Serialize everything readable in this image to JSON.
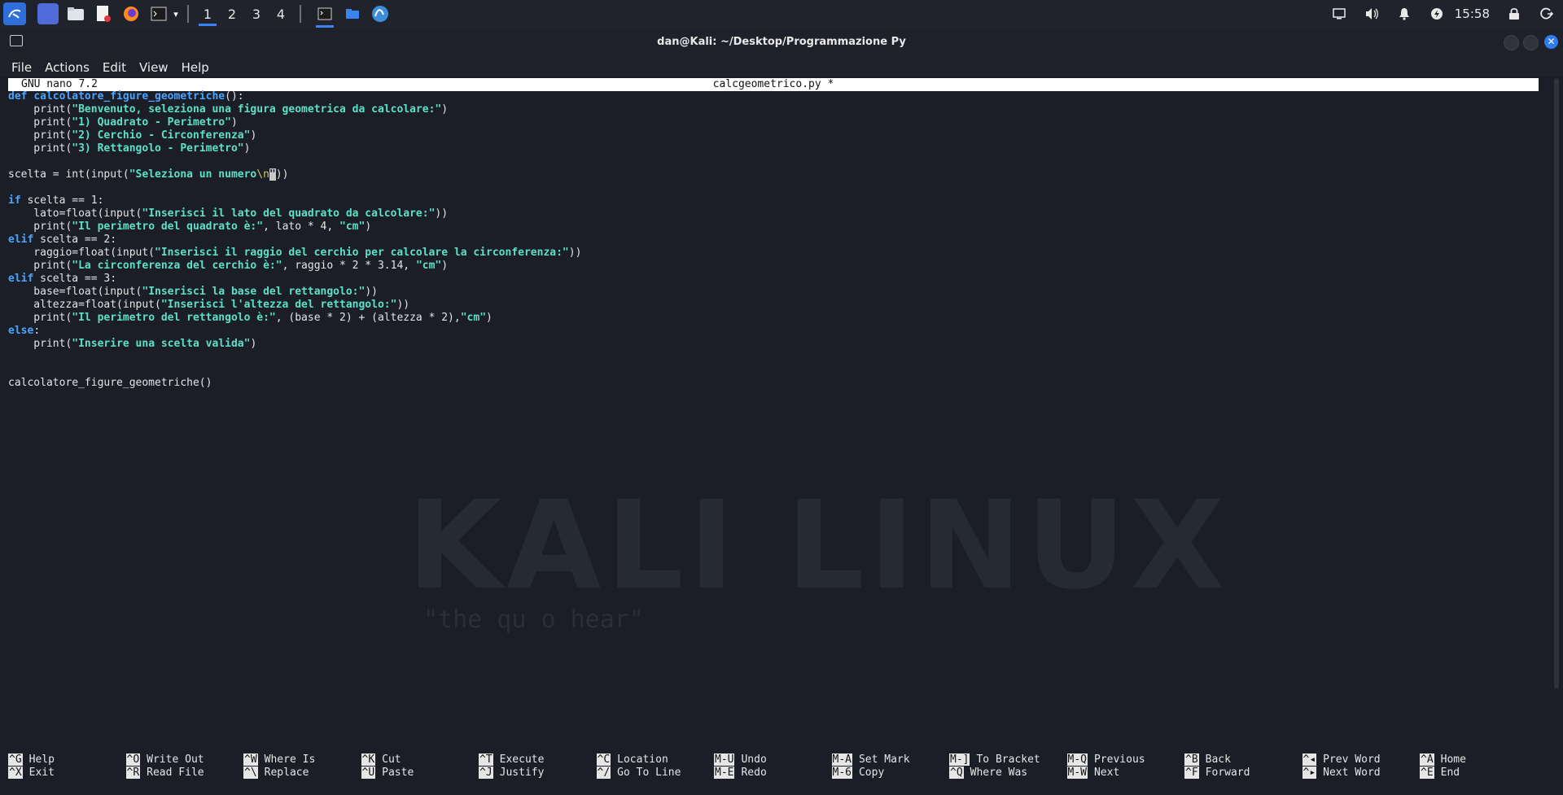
{
  "taskbar": {
    "workspaces": [
      "1",
      "2",
      "3",
      "4"
    ],
    "clock": "15:58"
  },
  "window": {
    "title": "dan@Kali: ~/Desktop/Programmazione Py"
  },
  "menu": [
    "File",
    "Actions",
    "Edit",
    "View",
    "Help"
  ],
  "nano": {
    "version": "GNU nano 7.2",
    "filename": "calcgeometrico.py *"
  },
  "background": {
    "art_text": "KALI LINUX",
    "quote": "\"the qu                                   o hear\""
  },
  "code": {
    "l1_kw": "def",
    "l1_fn": "calcolatore_figure_geometriche",
    "l1_rest": "():",
    "l2_a": "    print(",
    "l2_s": "\"Benvenuto, seleziona una figura geometrica da calcolare:\"",
    "l2_b": ")",
    "l3_a": "    print(",
    "l3_s": "\"1) Quadrato - Perimetro\"",
    "l3_b": ")",
    "l4_a": "    print(",
    "l4_s": "\"2) Cerchio - Circonferenza\"",
    "l4_b": ")",
    "l5_a": "    print(",
    "l5_s": "\"3) Rettangolo - Perimetro\"",
    "l5_b": ")",
    "l7_a": "scelta = int(input(",
    "l7_s": "\"Seleziona un numero",
    "l7_esc": "\\n",
    "l7_cur": "\"",
    "l7_b": "))",
    "l9_kw": "if",
    "l9_rest": " scelta == 1:",
    "l10_a": "    lato=float(input(",
    "l10_s": "\"Inserisci il lato del quadrato da calcolare:\"",
    "l10_b": "))",
    "l11_a": "    print(",
    "l11_s": "\"Il perimetro del quadrato è:\"",
    "l11_b": ", lato * 4, ",
    "l11_s2": "\"cm\"",
    "l11_c": ")",
    "l12_kw": "elif",
    "l12_rest": " scelta == 2:",
    "l13_a": "    raggio=float(input(",
    "l13_s": "\"Inserisci il raggio del cerchio per calcolare la circonferenza:\"",
    "l13_b": "))",
    "l14_a": "    print(",
    "l14_s": "\"La circonferenza del cerchio è:\"",
    "l14_b": ", raggio * 2 * 3.14, ",
    "l14_s2": "\"cm\"",
    "l14_c": ")",
    "l15_kw": "elif",
    "l15_rest": " scelta == 3:",
    "l16_a": "    base=float(input(",
    "l16_s": "\"Inserisci la base del rettangolo:\"",
    "l16_b": "))",
    "l17_a": "    altezza=float(input(",
    "l17_s": "\"Inserisci l'altezza del rettangolo:\"",
    "l17_b": "))",
    "l18_a": "    print(",
    "l18_s": "\"Il perimetro del rettangolo è:\"",
    "l18_b": ", (base * 2) + (altezza * 2),",
    "l18_s2": "\"cm\"",
    "l18_c": ")",
    "l19_kw": "else",
    "l19_rest": ":",
    "l20_a": "    print(",
    "l20_s": "\"Inserire una scelta valida\"",
    "l20_b": ")",
    "l23": "calcolatore_figure_geometriche()"
  },
  "shortcuts": [
    {
      "k1": "^G",
      "l1": "Help",
      "k2": "^X",
      "l2": "Exit"
    },
    {
      "k1": "^O",
      "l1": "Write Out",
      "k2": "^R",
      "l2": "Read File"
    },
    {
      "k1": "^W",
      "l1": "Where Is",
      "k2": "^\\",
      "l2": "Replace"
    },
    {
      "k1": "^K",
      "l1": "Cut",
      "k2": "^U",
      "l2": "Paste"
    },
    {
      "k1": "^T",
      "l1": "Execute",
      "k2": "^J",
      "l2": "Justify"
    },
    {
      "k1": "^C",
      "l1": "Location",
      "k2": "^/",
      "l2": "Go To Line"
    },
    {
      "k1": "M-U",
      "l1": "Undo",
      "k2": "M-E",
      "l2": "Redo"
    },
    {
      "k1": "M-A",
      "l1": "Set Mark",
      "k2": "M-6",
      "l2": "Copy"
    },
    {
      "k1": "M-]",
      "l1": "To Bracket",
      "k2": "^Q",
      "l2": "Where Was"
    },
    {
      "k1": "M-Q",
      "l1": "Previous",
      "k2": "M-W",
      "l2": "Next"
    },
    {
      "k1": "^B",
      "l1": "Back",
      "k2": "^F",
      "l2": "Forward"
    },
    {
      "k1": "^◂",
      "l1": "Prev Word",
      "k2": "^▸",
      "l2": "Next Word"
    },
    {
      "k1": "^A",
      "l1": "Home",
      "k2": "^E",
      "l2": "End"
    }
  ]
}
